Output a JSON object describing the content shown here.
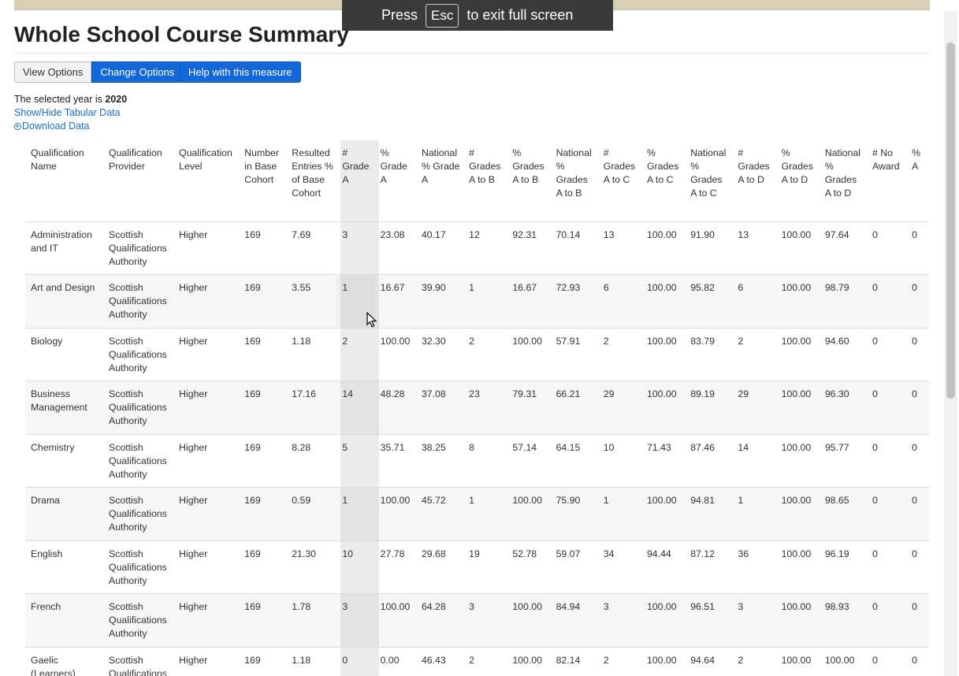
{
  "fullscreen_notice": {
    "press": "Press",
    "key": "Esc",
    "rest": "to exit full screen"
  },
  "page_title": "Whole School Course Summary",
  "buttons": {
    "view_options": "View Options",
    "change_options": "Change Options",
    "help": "Help with this measure"
  },
  "selected_year": {
    "label": "The selected year is",
    "value": "2020"
  },
  "links": {
    "show_hide": "Show/Hide Tabular Data",
    "download": "Download Data"
  },
  "table": {
    "columns": [
      "Qualification Name",
      "Qualification Provider",
      "Qualification Level",
      "Number in Base Cohort",
      "Resulted Entries % of Base Cohort",
      "# Grade A",
      "% Grade A",
      "National % Grade A",
      "# Grades A to B",
      "% Grades A to B",
      "National % Grades A to B",
      "# Grades A to C",
      "% Grades A to C",
      "National % Grades A to C",
      "# Grades A to D",
      "% Grades A to D",
      "National % Grades A to D",
      "# No Award",
      "% A"
    ],
    "rows": [
      [
        "Administration and IT",
        "Scottish Qualifications Authority",
        "Higher",
        "169",
        "7.69",
        "3",
        "23.08",
        "40.17",
        "12",
        "92.31",
        "70.14",
        "13",
        "100.00",
        "91.90",
        "13",
        "100.00",
        "97.64",
        "0",
        "0"
      ],
      [
        "Art and Design",
        "Scottish Qualifications Authority",
        "Higher",
        "169",
        "3.55",
        "1",
        "16.67",
        "39.90",
        "1",
        "16.67",
        "72.93",
        "6",
        "100.00",
        "95.82",
        "6",
        "100.00",
        "98.79",
        "0",
        "0"
      ],
      [
        "Biology",
        "Scottish Qualifications Authority",
        "Higher",
        "169",
        "1.18",
        "2",
        "100.00",
        "32.30",
        "2",
        "100.00",
        "57.91",
        "2",
        "100.00",
        "83.79",
        "2",
        "100.00",
        "94.60",
        "0",
        "0"
      ],
      [
        "Business Management",
        "Scottish Qualifications Authority",
        "Higher",
        "169",
        "17.16",
        "14",
        "48.28",
        "37.08",
        "23",
        "79.31",
        "66.21",
        "29",
        "100.00",
        "89.19",
        "29",
        "100.00",
        "96.30",
        "0",
        "0"
      ],
      [
        "Chemistry",
        "Scottish Qualifications Authority",
        "Higher",
        "169",
        "8.28",
        "5",
        "35.71",
        "38.25",
        "8",
        "57.14",
        "64.15",
        "10",
        "71.43",
        "87.46",
        "14",
        "100.00",
        "95.77",
        "0",
        "0"
      ],
      [
        "Drama",
        "Scottish Qualifications Authority",
        "Higher",
        "169",
        "0.59",
        "1",
        "100.00",
        "45.72",
        "1",
        "100.00",
        "75.90",
        "1",
        "100.00",
        "94.81",
        "1",
        "100.00",
        "98.65",
        "0",
        "0"
      ],
      [
        "English",
        "Scottish Qualifications Authority",
        "Higher",
        "169",
        "21.30",
        "10",
        "27.78",
        "29.68",
        "19",
        "52.78",
        "59.07",
        "34",
        "94.44",
        "87.12",
        "36",
        "100.00",
        "96.19",
        "0",
        "0"
      ],
      [
        "French",
        "Scottish Qualifications Authority",
        "Higher",
        "169",
        "1.78",
        "3",
        "100.00",
        "64.28",
        "3",
        "100.00",
        "84.94",
        "3",
        "100.00",
        "96.51",
        "3",
        "100.00",
        "98.93",
        "0",
        "0"
      ],
      [
        "Gaelic (Learners)",
        "Scottish Qualifications Authority",
        "Higher",
        "169",
        "1.18",
        "0",
        "0.00",
        "46.43",
        "2",
        "100.00",
        "82.14",
        "2",
        "100.00",
        "94.64",
        "2",
        "100.00",
        "100.00",
        "0",
        "0"
      ]
    ]
  },
  "colors": {
    "primary": "#1467d6",
    "link": "#1a6fc8",
    "highlight": "#ececec"
  }
}
